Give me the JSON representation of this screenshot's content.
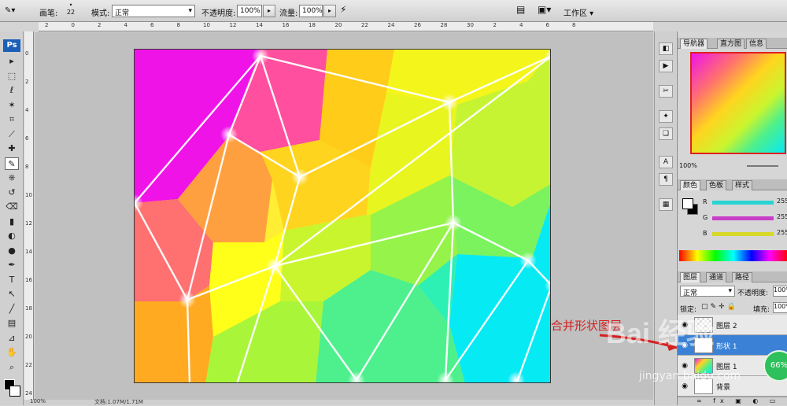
{
  "options_bar": {
    "brush_label": "画笔:",
    "brush_size": "22",
    "mode_label": "模式:",
    "mode_value": "正常",
    "opacity_label": "不透明度:",
    "opacity_value": "100%",
    "flow_label": "流量:",
    "flow_value": "100%",
    "workspace_label": "工作区"
  },
  "ruler_h_ticks": [
    "2",
    "0",
    "2",
    "4",
    "6",
    "8",
    "10",
    "12",
    "14",
    "16",
    "18",
    "20",
    "22",
    "24",
    "26",
    "28",
    "30",
    "2",
    "4",
    "6",
    "8"
  ],
  "ruler_v_ticks": [
    "0",
    "2",
    "4",
    "6",
    "8",
    "10",
    "12",
    "14",
    "16",
    "18",
    "20",
    "22",
    "24"
  ],
  "toolbox": {
    "logo": "Ps",
    "tools": [
      "move-tool",
      "marquee-tool",
      "lasso-tool",
      "magic-wand-tool",
      "crop-tool",
      "slice-tool",
      "healing-tool",
      "brush-tool",
      "stamp-tool",
      "history-brush-tool",
      "eraser-tool",
      "gradient-tool",
      "blur-tool",
      "dodge-tool",
      "pen-tool",
      "type-tool",
      "path-select-tool",
      "shape-tool",
      "notes-tool",
      "eyedropper-tool",
      "hand-tool",
      "zoom-tool"
    ]
  },
  "navigator": {
    "tabs": [
      "导航器",
      "直方图",
      "信息"
    ],
    "zoom": "100%"
  },
  "color_panel": {
    "tabs": [
      "颜色",
      "色板",
      "样式"
    ],
    "channels": [
      {
        "label": "R",
        "value": "255",
        "color": "#29d3d3"
      },
      {
        "label": "G",
        "value": "255",
        "color": "#c83ec8"
      },
      {
        "label": "B",
        "value": "255",
        "color": "#d8d82a"
      }
    ]
  },
  "layers_panel": {
    "tabs": [
      "图层",
      "通道",
      "路径"
    ],
    "blend_mode": "正常",
    "opacity_label": "不透明度:",
    "opacity_value": "100%",
    "lock_label": "锁定:",
    "fill_label": "填充:",
    "fill_value": "100%",
    "layers": [
      {
        "name": "图层 2",
        "selected": false
      },
      {
        "name": "形状 1",
        "selected": true
      },
      {
        "name": "图层 1",
        "selected": false
      },
      {
        "name": "背景",
        "selected": false
      }
    ]
  },
  "annotation": "合并形状图层",
  "watermark": {
    "text": "Bai 经验",
    "url": "jingyan.baidu.com"
  },
  "badge": "66%",
  "status": {
    "zoom": "100%",
    "doc": "文档:1.07M/1.71M"
  },
  "colors": {
    "selection": "#3b82d6",
    "annotation": "#d32020"
  }
}
